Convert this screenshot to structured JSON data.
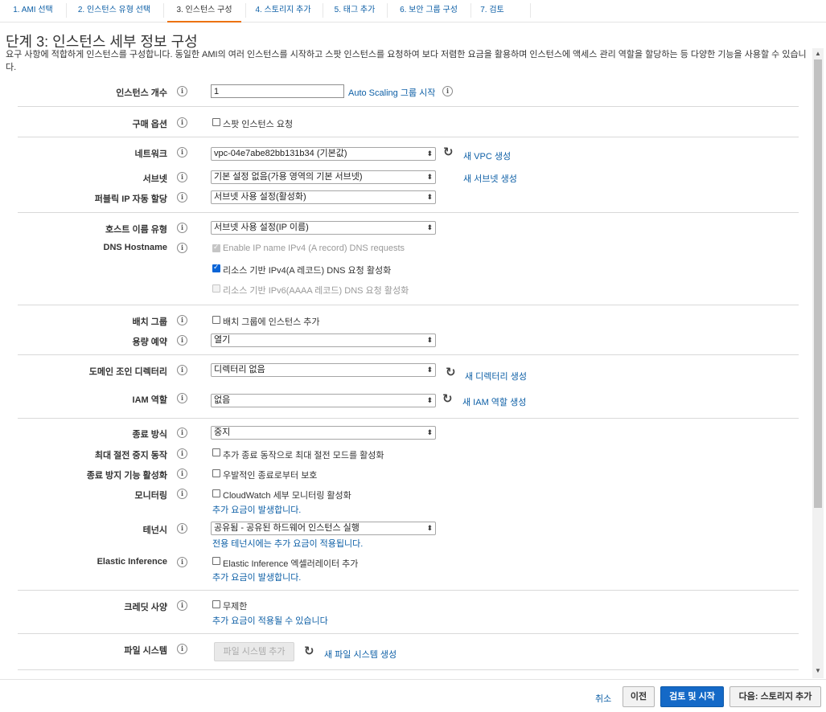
{
  "tabs": [
    {
      "label": "1. AMI 선택"
    },
    {
      "label": "2. 인스턴스 유형 선택"
    },
    {
      "label": "3. 인스턴스 구성"
    },
    {
      "label": "4. 스토리지 추가"
    },
    {
      "label": "5. 태그 추가"
    },
    {
      "label": "6. 보안 그룹 구성"
    },
    {
      "label": "7. 검토"
    }
  ],
  "page": {
    "title": "단계 3: 인스턴스 세부 정보 구성",
    "description": "요구 사항에 적합하게 인스턴스를 구성합니다. 동일한 AMI의 여러 인스턴스를 시작하고 스팟 인스턴스를 요청하여 보다 저렴한 요금을 활용하며 인스턴스에 액세스 관리 역할을 할당하는 등 다양한 기능을 사용할 수 있습니다."
  },
  "form": {
    "instance_count": {
      "label": "인스턴스 개수",
      "value": "1",
      "link": "Auto Scaling 그룹 시작"
    },
    "purchase_option": {
      "label": "구매 옵션",
      "checkbox": "스팟 인스턴스 요청"
    },
    "network": {
      "label": "네트워크",
      "value": "vpc-04e7abe82bb131b34 (기본값)",
      "link": "새 VPC 생성"
    },
    "subnet": {
      "label": "서브넷",
      "value": "기본 설정 없음(가용 영역의 기본 서브넷)",
      "link": "새 서브넷 생성"
    },
    "public_ip": {
      "label": "퍼블릭 IP 자동 할당",
      "value": "서브넷 사용 설정(활성화)"
    },
    "hostname_type": {
      "label": "호스트 이름 유형",
      "value": "서브넷 사용 설정(IP 이름)"
    },
    "dns_hostname": {
      "label": "DNS Hostname",
      "opt1": "Enable IP name IPv4 (A record) DNS requests",
      "opt2": "리소스 기반 IPv4(A 레코드) DNS 요청 활성화",
      "opt3": "리소스 기반 IPv6(AAAA 레코드) DNS 요청 활성화"
    },
    "placement_group": {
      "label": "배치 그룹",
      "checkbox": "배치 그룹에 인스턴스 추가"
    },
    "capacity_reservation": {
      "label": "용량 예약",
      "value": "열기"
    },
    "domain_join": {
      "label": "도메인 조인 디렉터리",
      "value": "디렉터리 없음",
      "link": "새 디렉터리 생성"
    },
    "iam_role": {
      "label": "IAM 역할",
      "value": "없음",
      "link": "새 IAM 역할 생성"
    },
    "shutdown_behavior": {
      "label": "종료 방식",
      "value": "중지"
    },
    "stop_hibernate": {
      "label": "최대 절전 중지 동작",
      "checkbox": "추가 종료 동작으로 최대 절전 모드를 활성화"
    },
    "termination_protection": {
      "label": "종료 방지 기능 활성화",
      "checkbox": "우발적인 종료로부터 보호"
    },
    "monitoring": {
      "label": "모니터링",
      "checkbox": "CloudWatch 세부 모니터링 활성화",
      "note": "추가 요금이 발생합니다."
    },
    "tenancy": {
      "label": "테넌시",
      "value": "공유됨 - 공유된 하드웨어 인스턴스 실행",
      "note": "전용 테넌시에는 추가 요금이 적용됩니다."
    },
    "elastic_inference": {
      "label": "Elastic Inference",
      "checkbox": "Elastic Inference 엑셀러레이터 추가",
      "note": "추가 요금이 발생합니다."
    },
    "credit_spec": {
      "label": "크레딧 사양",
      "checkbox": "무제한",
      "note": "추가 요금이 적용될 수 있습니다"
    },
    "file_systems": {
      "label": "파일 시스템",
      "button": "파일 시스템 추가",
      "link": "새 파일 시스템 생성"
    }
  },
  "footer": {
    "cancel": "취소",
    "previous": "이전",
    "review_launch": "검토 및 시작",
    "next": "다음: 스토리지 추가"
  },
  "icons": {
    "info": "i",
    "refresh": "↻",
    "dropdown": "⬍"
  }
}
